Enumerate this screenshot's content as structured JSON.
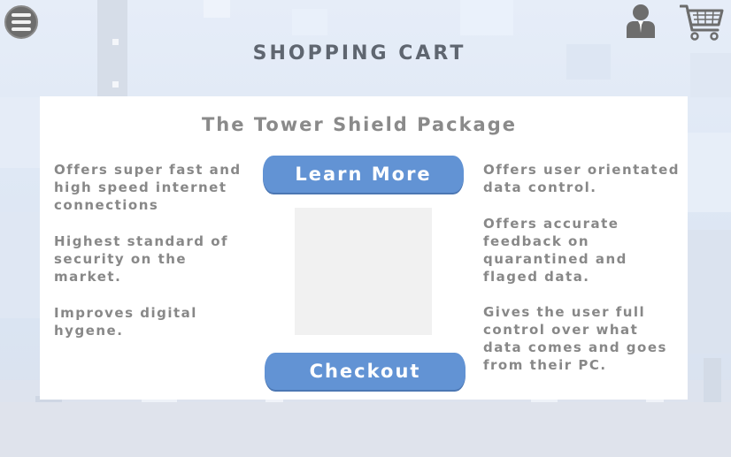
{
  "header": {
    "title": "SHOPPING CART",
    "menu_icon": "hamburger-menu-icon",
    "user_icon": "user-profile-icon",
    "cart_icon": "shopping-cart-icon"
  },
  "package": {
    "title": "The Tower Shield Package",
    "left_features": [
      "Offers super fast and high speed internet connections",
      "Highest standard of security on the market.",
      "Improves digital hygene."
    ],
    "right_features": [
      "Offers user orientated data control.",
      "Offers accurate feedback on quarantined and flaged data.",
      "Gives the user full control over what data comes and goes from their PC."
    ],
    "learn_more_label": "Learn More",
    "checkout_label": "Checkout"
  },
  "colors": {
    "button": "#6293d4",
    "title": "#5f6670",
    "text": "#888888",
    "panel": "#ffffff",
    "background": "#e3ebf6"
  }
}
